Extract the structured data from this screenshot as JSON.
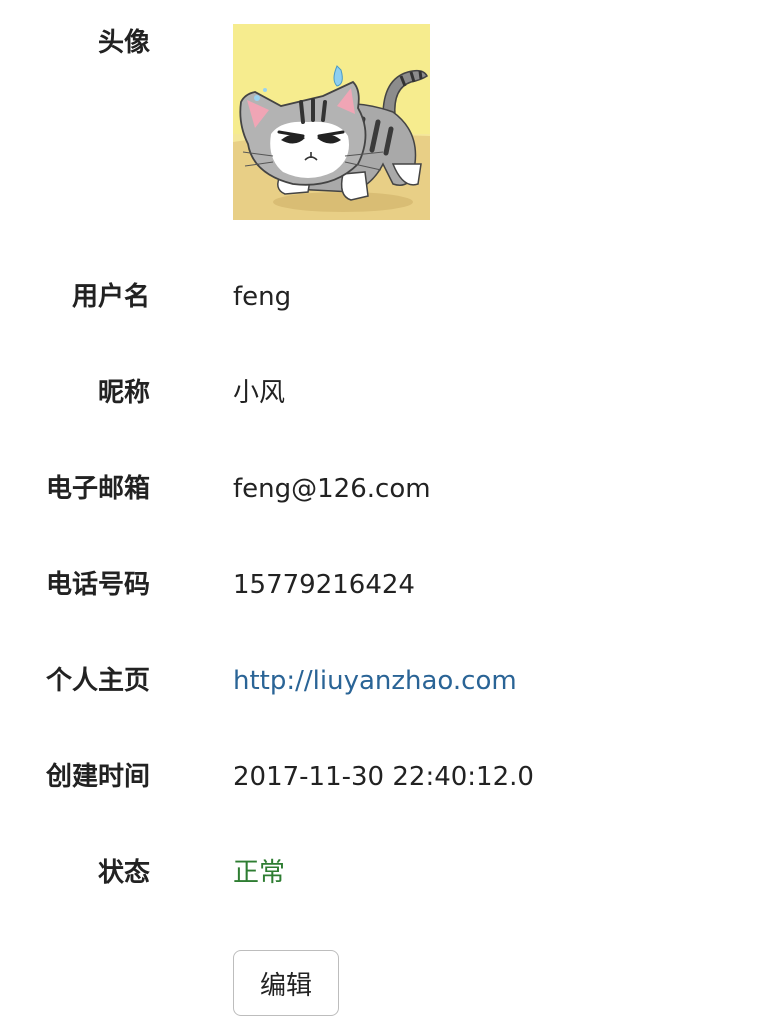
{
  "profile": {
    "avatar_label": "头像",
    "username_label": "用户名",
    "username": "feng",
    "nickname_label": "昵称",
    "nickname": "小风",
    "email_label": "电子邮箱",
    "email": "feng@126.com",
    "phone_label": "电话号码",
    "phone": "15779216424",
    "homepage_label": "个人主页",
    "homepage": "http://liuyanzhao.com",
    "created_label": "创建时间",
    "created": "2017-11-30 22:40:12.0",
    "status_label": "状态",
    "status": "正常"
  },
  "actions": {
    "edit_label": "编辑"
  },
  "colors": {
    "link": "#2a6496",
    "status_ok": "#2e7d32"
  },
  "avatar": {
    "icon": "cat-avatar-image"
  }
}
